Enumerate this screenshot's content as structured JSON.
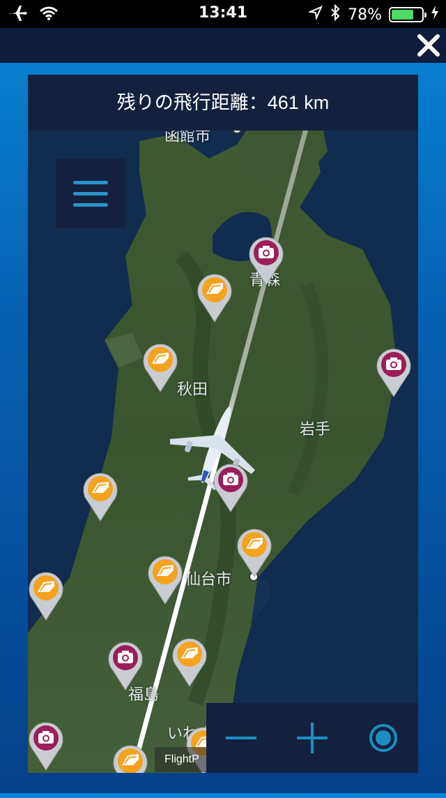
{
  "status_bar": {
    "time": "13:41",
    "battery_percent": "78%",
    "battery_level": 0.78,
    "icons": [
      "airplane-mode-icon",
      "wifi-icon",
      "location-arrow-icon",
      "bluetooth-icon",
      "battery-icon",
      "charging-bolt-icon"
    ]
  },
  "header": {
    "close_icon": "close-icon"
  },
  "banner": {
    "remaining_distance": "残りの飛行距離：461 km"
  },
  "map": {
    "places": [
      {
        "name": "函館市"
      },
      {
        "name": "青森"
      },
      {
        "name": "秋田"
      },
      {
        "name": "岩手"
      },
      {
        "name": "仙台市"
      },
      {
        "name": "福島"
      },
      {
        "name": "いわき"
      }
    ],
    "attribution": "FlightP",
    "pins": {
      "camera": "camera-pin-icon",
      "landmark": "landmark-pin-icon"
    },
    "route_color": "#ffffff",
    "camera_pin_color": "#9a1e5a",
    "landmark_pin_color": "#f5a21e"
  },
  "controls": {
    "menu_icon": "hamburger-menu-icon",
    "zoom_out_icon": "minus-icon",
    "zoom_in_icon": "plus-icon",
    "center_icon": "locate-target-icon",
    "accent_color": "#1b8fc0"
  }
}
